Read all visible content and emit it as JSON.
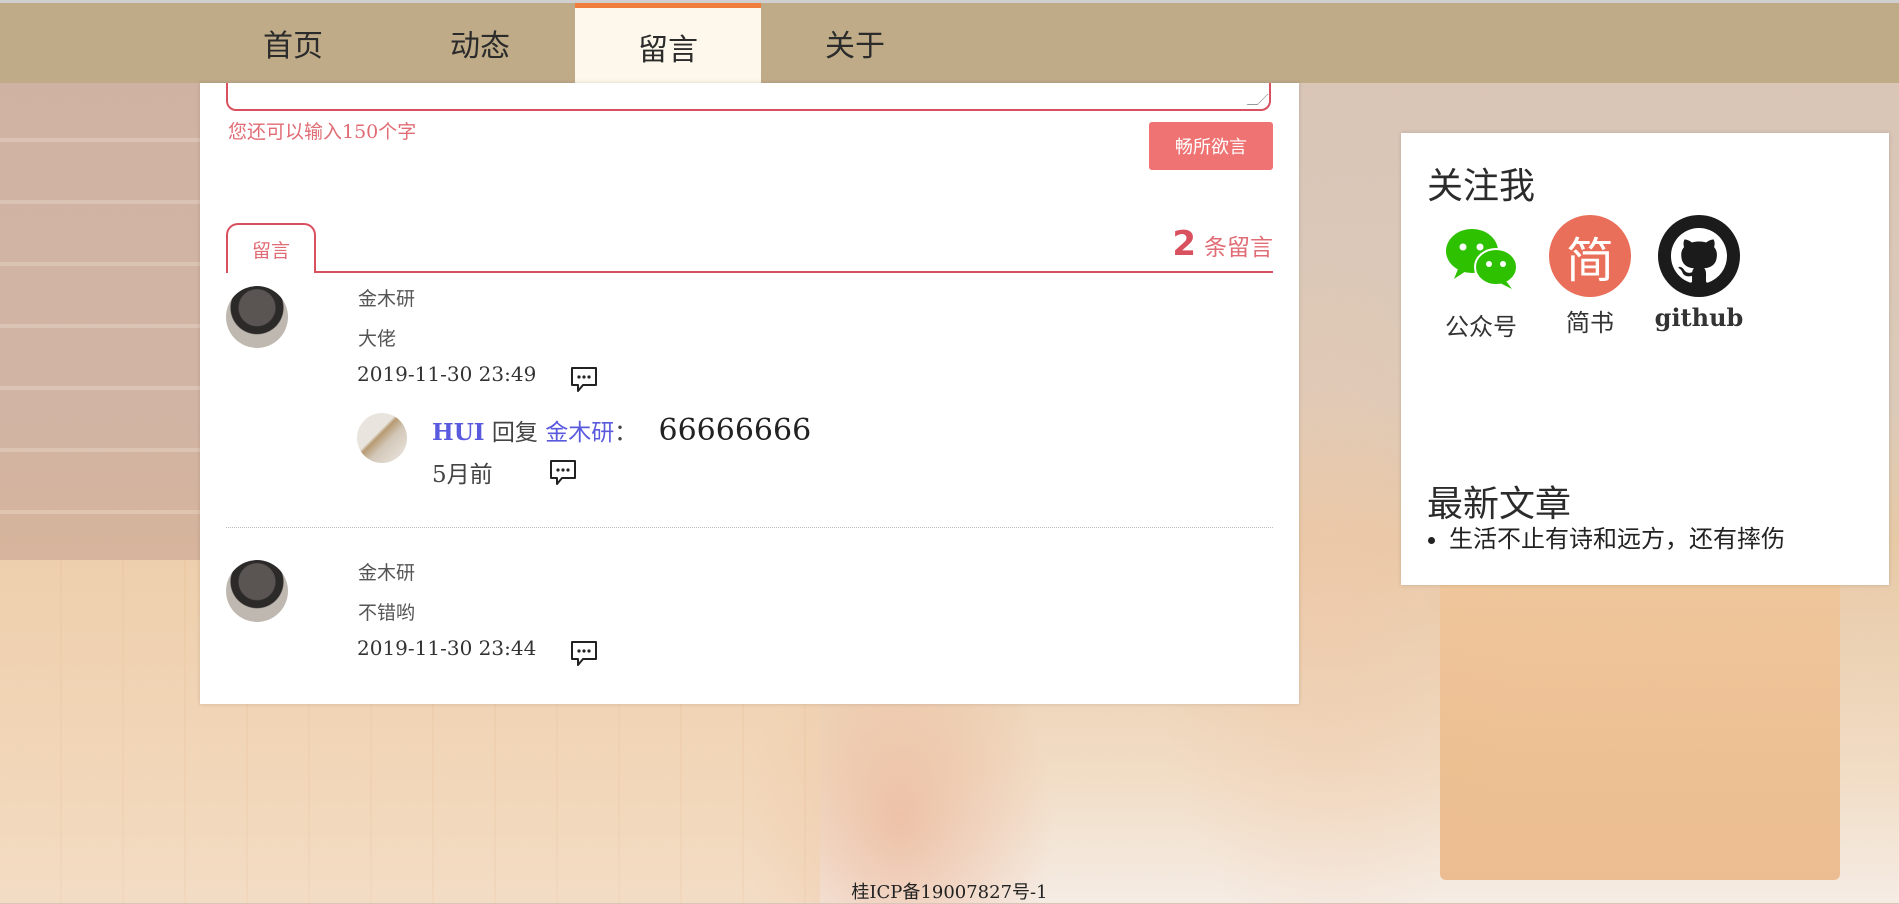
{
  "nav": {
    "items": [
      "首页",
      "动态",
      "留言",
      "关于"
    ],
    "active_index": 2
  },
  "editor": {
    "char_hint": "您还可以输入150个字",
    "submit_label": "畅所欲言"
  },
  "comments_header": {
    "tab_label": "留言",
    "count": "2",
    "count_suffix": "条留言"
  },
  "comments": [
    {
      "name": "金木研",
      "text": "大佬",
      "time": "2019-11-30 23:49",
      "replies": [
        {
          "user": "HUI",
          "verb": "回复",
          "target": "金木研",
          "colon": "：",
          "message": "66666666",
          "time": "5月前"
        }
      ]
    },
    {
      "name": "金木研",
      "text": "不错哟",
      "time": "2019-11-30 23:44",
      "replies": []
    }
  ],
  "sidebar": {
    "follow_title": "关注我",
    "follow_items": [
      {
        "label": "公众号",
        "icon": "wechat-icon"
      },
      {
        "label": "简书",
        "icon": "jianshu-icon",
        "glyph": "简"
      },
      {
        "label": "github",
        "icon": "github-icon"
      }
    ],
    "articles_title": "最新文章",
    "articles": [
      "生活不止有诗和远方，还有摔伤"
    ]
  },
  "footer": {
    "icp": "桂ICP备19007827号-1"
  },
  "colors": {
    "nav_bg": "#bfab88",
    "nav_active_bg": "#fdf8eb",
    "nav_active_border": "#ef7d3c",
    "accent_red": "#d9505f",
    "button_bg": "#f07373",
    "link_blue": "#5a5adf"
  }
}
